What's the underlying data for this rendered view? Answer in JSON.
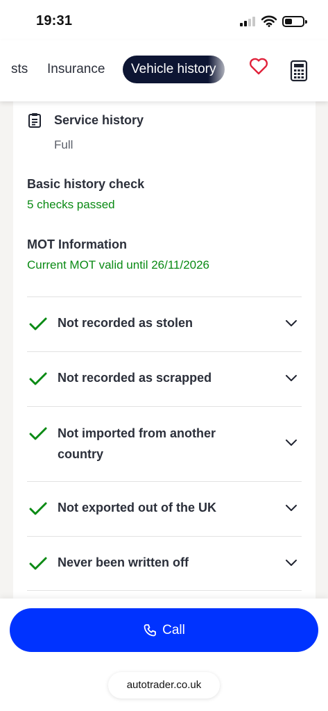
{
  "status": {
    "time": "19:31"
  },
  "tabs": [
    {
      "label": "sts"
    },
    {
      "label": "Insurance"
    },
    {
      "label": "Vehicle history",
      "active": true
    }
  ],
  "icons": {
    "heart": "heart-outline-icon",
    "calculator": "calculator-icon",
    "service": "clipboard-icon",
    "check": "check-icon",
    "chevron": "chevron-down-icon",
    "phone": "phone-icon"
  },
  "service_history": {
    "label": "Service history",
    "value": "Full"
  },
  "basic_check": {
    "label": "Basic history check",
    "value": "5 checks passed"
  },
  "mot": {
    "label": "MOT Information",
    "value": "Current MOT valid until 26/11/2026"
  },
  "checks": [
    {
      "text": "Not recorded as stolen"
    },
    {
      "text": "Not recorded as scrapped"
    },
    {
      "text": "Not imported from another country"
    },
    {
      "text": "Not exported out of the UK"
    },
    {
      "text": "Never been written off"
    }
  ],
  "call": {
    "label": "Call"
  },
  "browser": {
    "url": "autotrader.co.uk"
  },
  "colors": {
    "accent": "#0033ff",
    "active_tab": "#0d1533",
    "success": "#0a8a14",
    "heart": "#e0213a"
  }
}
